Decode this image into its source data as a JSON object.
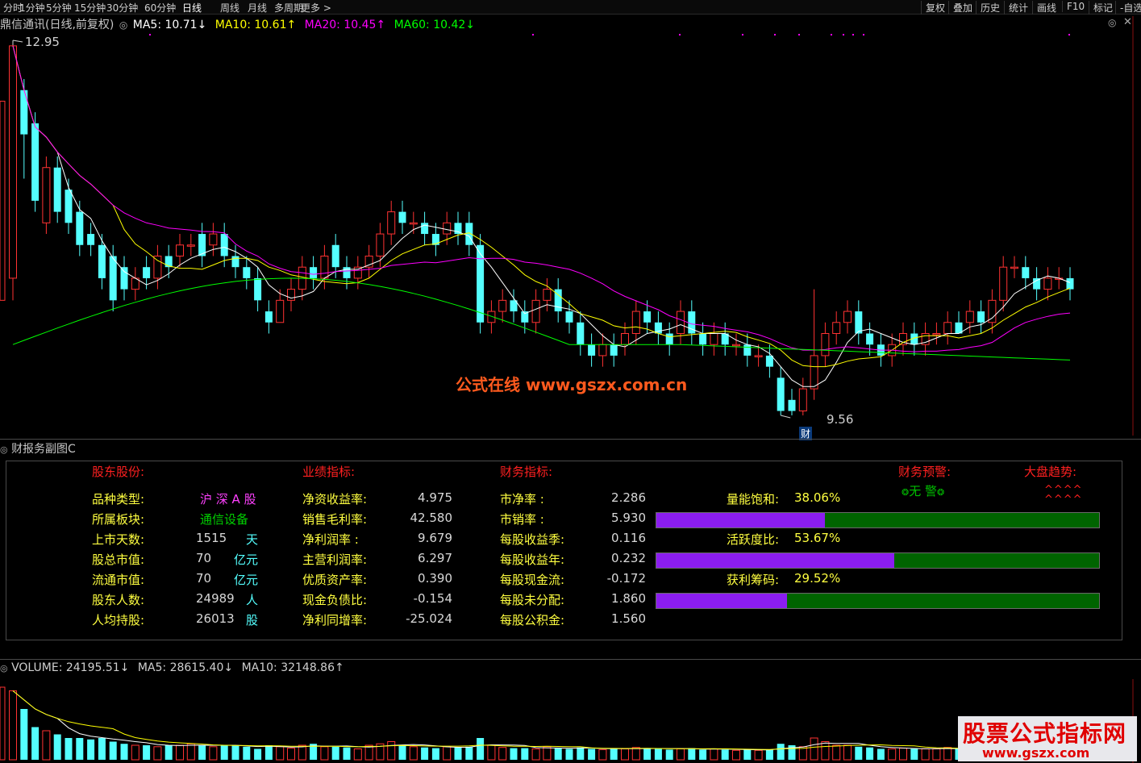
{
  "toolbar": {
    "periods": [
      "分时",
      "1分钟",
      "5分钟",
      "15分钟",
      "30分钟",
      "60分钟",
      "日线",
      "周线",
      "月线",
      "多周期",
      "更多 >"
    ],
    "active_period": "日线",
    "right": [
      "复权",
      "叠加",
      "历史",
      "统计",
      "画线",
      "F10",
      "标记",
      "-自选"
    ]
  },
  "main_chart": {
    "title": "鼎信通讯(日线,前复权)",
    "ma5": "MA5: 10.71↓",
    "ma10": "MA10: 10.61↑",
    "ma20": "MA20: 10.45↑",
    "ma60": "MA60: 10.42↓",
    "high_label": "12.95",
    "low_label": "9.56",
    "fin_marker": "财",
    "watermark": "公式在线  www.gszx.com.cn",
    "colors": {
      "up": "#ff3232",
      "down": "#54ffff",
      "ma5": "#ffffff",
      "ma10": "#ffff00",
      "ma20": "#ff00ff",
      "ma60": "#00ff00"
    }
  },
  "fin_panel": {
    "title": "财报务副图C",
    "section_holders": "股东股份:",
    "section_perf": "业绩指标:",
    "section_fin": "财务指标:",
    "section_warn": "财务预警:",
    "section_trend": "大盘趋势:",
    "warn_value": "无 警",
    "trend_line1": "^^^^",
    "trend_line2": "^^^^",
    "holders": [
      {
        "label": "品种类型:",
        "value": "沪 深 A 股",
        "unit": ""
      },
      {
        "label": "所属板块:",
        "value": "通信设备",
        "unit": ""
      },
      {
        "label": "上市天数:",
        "value": "1515",
        "unit": "天"
      },
      {
        "label": "股总市值:",
        "value": "70",
        "unit": "亿元"
      },
      {
        "label": "流通市值:",
        "value": "70",
        "unit": "亿元"
      },
      {
        "label": "股东人数:",
        "value": "24989",
        "unit": "人"
      },
      {
        "label": "人均持股:",
        "value": "26013",
        "unit": "股"
      }
    ],
    "perf": [
      {
        "label": "净资收益率:",
        "value": "4.975"
      },
      {
        "label": "销售毛利率:",
        "value": "42.580"
      },
      {
        "label": "净利润率 :",
        "value": "9.679"
      },
      {
        "label": "主营利润率:",
        "value": "6.297"
      },
      {
        "label": "优质资产率:",
        "value": "0.390"
      },
      {
        "label": "现金负债比:",
        "value": "-0.154"
      },
      {
        "label": "净利同增率:",
        "value": "-25.024"
      }
    ],
    "fin": [
      {
        "label": "市净率 :",
        "value": "2.286"
      },
      {
        "label": "市销率 :",
        "value": "5.930"
      },
      {
        "label": "每股收益季:",
        "value": "0.116"
      },
      {
        "label": "每股收益年:",
        "value": "0.232"
      },
      {
        "label": "每股现金流:",
        "value": "-0.172"
      },
      {
        "label": "每股未分配:",
        "value": "1.860"
      },
      {
        "label": "每股公积金:",
        "value": "1.560"
      }
    ],
    "meters": [
      {
        "label": "量能饱和:",
        "value": "38.06%",
        "fraction": 0.3806
      },
      {
        "label": "活跃度比:",
        "value": "53.67%",
        "fraction": 0.5367
      },
      {
        "label": "获利筹码:",
        "value": "29.52%",
        "fraction": 0.2952
      }
    ]
  },
  "volume": {
    "label": "VOLUME: 24195.51↓",
    "ma5": "MA5: 28615.40↓",
    "ma10": "MA10: 32148.86↑"
  },
  "site_watermark": {
    "title": "股票公式指标网",
    "url": "www.gszx.com"
  },
  "candles": [
    [
      10.8,
      12.9,
      10.6,
      12.95
    ],
    [
      12.5,
      12.1,
      11.7,
      12.6
    ],
    [
      12.2,
      11.5,
      11.4,
      12.3
    ],
    [
      11.3,
      11.8,
      11.2,
      11.9
    ],
    [
      11.8,
      11.4,
      11.3,
      11.9
    ],
    [
      11.6,
      11.3,
      11.2,
      11.7
    ],
    [
      11.4,
      11.1,
      11.0,
      11.5
    ],
    [
      11.2,
      11.1,
      11.0,
      11.3
    ],
    [
      11.1,
      10.8,
      10.7,
      11.2
    ],
    [
      11.0,
      10.6,
      10.5,
      11.1
    ],
    [
      10.9,
      10.7,
      10.6,
      11.0
    ],
    [
      10.7,
      10.8,
      10.6,
      10.9
    ],
    [
      10.9,
      10.8,
      10.7,
      11.0
    ],
    [
      10.8,
      11.0,
      10.7,
      11.1
    ],
    [
      11.0,
      10.9,
      10.8,
      11.1
    ],
    [
      11.0,
      11.1,
      10.9,
      11.2
    ],
    [
      11.1,
      11.1,
      11.0,
      11.2
    ],
    [
      11.2,
      11.0,
      10.9,
      11.3
    ],
    [
      11.1,
      11.2,
      11.0,
      11.3
    ],
    [
      11.2,
      11.0,
      10.9,
      11.3
    ],
    [
      11.0,
      10.9,
      10.8,
      11.1
    ],
    [
      10.9,
      10.8,
      10.7,
      11.0
    ],
    [
      10.8,
      10.6,
      10.5,
      10.9
    ],
    [
      10.5,
      10.4,
      10.3,
      10.6
    ],
    [
      10.4,
      10.6,
      10.4,
      10.7
    ],
    [
      10.6,
      10.7,
      10.5,
      10.8
    ],
    [
      10.7,
      10.9,
      10.6,
      11.0
    ],
    [
      10.9,
      10.8,
      10.7,
      11.0
    ],
    [
      10.8,
      11.0,
      10.7,
      11.1
    ],
    [
      11.1,
      10.9,
      10.8,
      11.2
    ],
    [
      10.9,
      10.8,
      10.7,
      11.0
    ],
    [
      10.8,
      10.9,
      10.7,
      11.0
    ],
    [
      10.9,
      11.0,
      10.8,
      11.1
    ],
    [
      11.0,
      11.2,
      10.9,
      11.3
    ],
    [
      11.2,
      11.4,
      11.1,
      11.5
    ],
    [
      11.4,
      11.3,
      11.2,
      11.5
    ],
    [
      11.3,
      11.3,
      11.2,
      11.4
    ],
    [
      11.3,
      11.2,
      11.1,
      11.4
    ],
    [
      11.2,
      11.1,
      11.0,
      11.3
    ],
    [
      11.2,
      11.3,
      11.1,
      11.4
    ],
    [
      11.3,
      11.2,
      11.1,
      11.4
    ],
    [
      11.3,
      11.1,
      11.0,
      11.4
    ],
    [
      11.1,
      10.4,
      10.3,
      11.2
    ],
    [
      10.4,
      10.5,
      10.3,
      10.6
    ],
    [
      10.5,
      10.6,
      10.4,
      10.7
    ],
    [
      10.6,
      10.5,
      10.4,
      10.7
    ],
    [
      10.5,
      10.4,
      10.3,
      10.6
    ],
    [
      10.4,
      10.6,
      10.3,
      10.7
    ],
    [
      10.6,
      10.7,
      10.5,
      10.8
    ],
    [
      10.7,
      10.5,
      10.4,
      10.8
    ],
    [
      10.5,
      10.4,
      10.3,
      10.6
    ],
    [
      10.4,
      10.2,
      10.1,
      10.5
    ],
    [
      10.2,
      10.1,
      10.0,
      10.3
    ],
    [
      10.1,
      10.2,
      10.0,
      10.3
    ],
    [
      10.2,
      10.1,
      10.0,
      10.3
    ],
    [
      10.2,
      10.3,
      10.1,
      10.4
    ],
    [
      10.3,
      10.5,
      10.2,
      10.6
    ],
    [
      10.5,
      10.4,
      10.3,
      10.6
    ],
    [
      10.4,
      10.3,
      10.2,
      10.5
    ],
    [
      10.3,
      10.2,
      10.1,
      10.4
    ],
    [
      10.3,
      10.5,
      10.2,
      10.6
    ],
    [
      10.5,
      10.3,
      10.2,
      10.6
    ],
    [
      10.3,
      10.2,
      10.1,
      10.4
    ],
    [
      10.2,
      10.3,
      10.1,
      10.4
    ],
    [
      10.3,
      10.2,
      10.1,
      10.4
    ],
    [
      10.2,
      10.2,
      10.1,
      10.3
    ],
    [
      10.2,
      10.1,
      10.0,
      10.3
    ],
    [
      10.1,
      10.1,
      10.0,
      10.2
    ],
    [
      10.1,
      10.0,
      9.9,
      10.2
    ],
    [
      9.9,
      9.6,
      9.56,
      10.0
    ],
    [
      9.7,
      9.6,
      9.56,
      9.8
    ],
    [
      9.6,
      9.8,
      9.56,
      9.9
    ],
    [
      9.8,
      10.1,
      9.7,
      10.7
    ],
    [
      10.1,
      10.3,
      10.0,
      10.4
    ],
    [
      10.3,
      10.4,
      10.2,
      10.5
    ],
    [
      10.4,
      10.5,
      10.3,
      10.6
    ],
    [
      10.5,
      10.3,
      10.2,
      10.6
    ],
    [
      10.3,
      10.2,
      10.1,
      10.4
    ],
    [
      10.2,
      10.1,
      10.0,
      10.3
    ],
    [
      10.1,
      10.2,
      10.0,
      10.3
    ],
    [
      10.2,
      10.3,
      10.1,
      10.4
    ],
    [
      10.3,
      10.2,
      10.1,
      10.4
    ],
    [
      10.2,
      10.3,
      10.1,
      10.4
    ],
    [
      10.3,
      10.3,
      10.2,
      10.4
    ],
    [
      10.3,
      10.4,
      10.2,
      10.5
    ],
    [
      10.4,
      10.3,
      10.3,
      10.5
    ],
    [
      10.4,
      10.5,
      10.3,
      10.6
    ],
    [
      10.5,
      10.4,
      10.3,
      10.6
    ],
    [
      10.4,
      10.6,
      10.3,
      10.7
    ],
    [
      10.6,
      10.9,
      10.5,
      11.0
    ],
    [
      10.9,
      10.9,
      10.8,
      11.0
    ],
    [
      10.9,
      10.8,
      10.7,
      11.0
    ],
    [
      10.8,
      10.7,
      10.6,
      10.9
    ],
    [
      10.7,
      10.8,
      10.6,
      10.9
    ],
    [
      10.8,
      10.8,
      10.7,
      10.9
    ],
    [
      10.8,
      10.7,
      10.6,
      10.9
    ]
  ],
  "vols": [
    0.95,
    0.7,
    0.45,
    0.4,
    0.35,
    0.3,
    0.3,
    0.28,
    0.3,
    0.25,
    0.22,
    0.2,
    0.2,
    0.18,
    0.2,
    0.2,
    0.22,
    0.2,
    0.18,
    0.2,
    0.2,
    0.18,
    0.15,
    0.2,
    0.18,
    0.16,
    0.2,
    0.22,
    0.18,
    0.18,
    0.17,
    0.15,
    0.2,
    0.22,
    0.25,
    0.2,
    0.18,
    0.17,
    0.16,
    0.18,
    0.17,
    0.18,
    0.3,
    0.2,
    0.17,
    0.16,
    0.16,
    0.15,
    0.18,
    0.16,
    0.15,
    0.17,
    0.15,
    0.14,
    0.15,
    0.15,
    0.17,
    0.16,
    0.15,
    0.14,
    0.15,
    0.16,
    0.14,
    0.15,
    0.14,
    0.13,
    0.14,
    0.13,
    0.14,
    0.22,
    0.2,
    0.18,
    0.3,
    0.25,
    0.2,
    0.2,
    0.18,
    0.17,
    0.15,
    0.15,
    0.16,
    0.15,
    0.15,
    0.15,
    0.17,
    0.15,
    0.16,
    0.15,
    0.18,
    0.25,
    0.2,
    0.18,
    0.17,
    0.16,
    0.15,
    0.15
  ]
}
